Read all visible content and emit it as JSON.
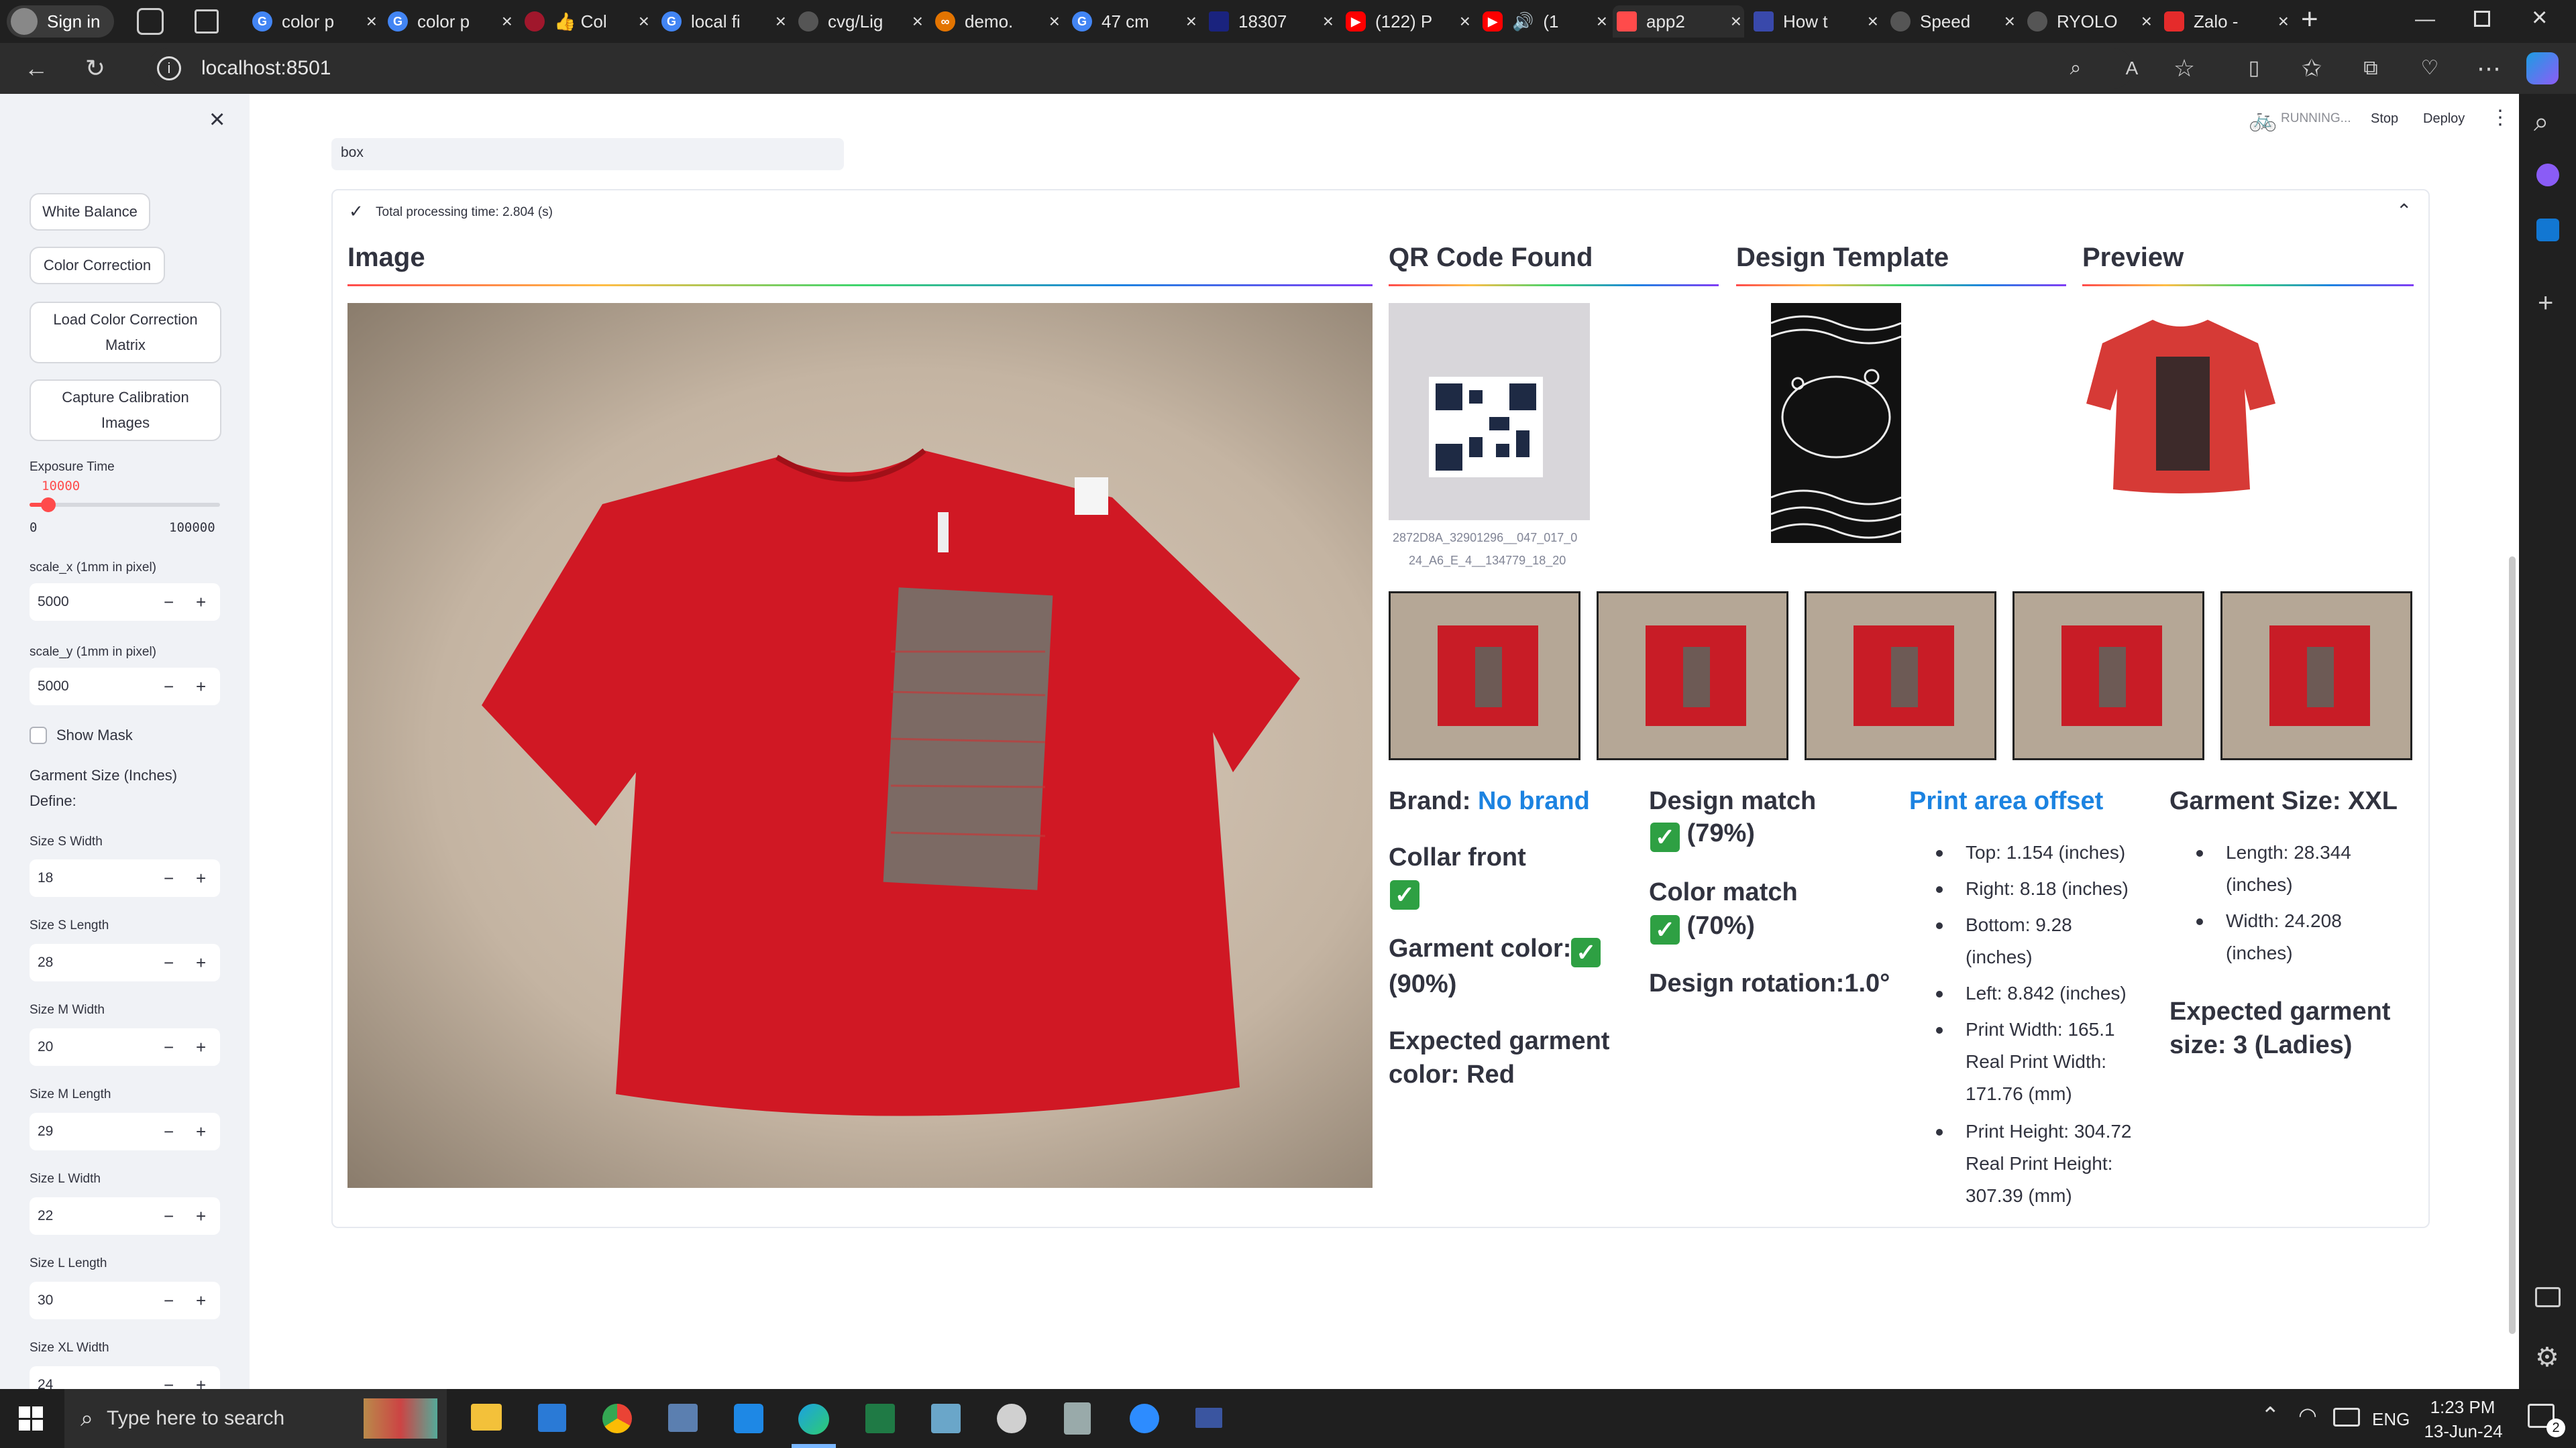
{
  "browser": {
    "profile_label": "Sign in",
    "tabs": [
      {
        "title": "color p",
        "icon": "google-icon"
      },
      {
        "title": "color p",
        "icon": "google-icon"
      },
      {
        "title": "👍 Col",
        "icon": "tool-icon"
      },
      {
        "title": "local fi",
        "icon": "google-icon"
      },
      {
        "title": "cvg/Lig",
        "icon": "github-icon"
      },
      {
        "title": "demo.",
        "icon": "infinity-icon"
      },
      {
        "title": "47 cm",
        "icon": "google-icon"
      },
      {
        "title": "18307",
        "icon": "app-icon"
      },
      {
        "title": "(122) P",
        "icon": "youtube-icon"
      },
      {
        "title": "(1",
        "icon": "youtube-icon"
      },
      {
        "title": "app2",
        "icon": "streamlit-icon"
      },
      {
        "title": "How t",
        "icon": "terminal-icon"
      },
      {
        "title": "Speed",
        "icon": "github-icon"
      },
      {
        "title": "RYOLO",
        "icon": "github-icon"
      },
      {
        "title": "Zalo -",
        "icon": "zalo-icon"
      }
    ],
    "url": "localhost:8501"
  },
  "streamlit_header": {
    "status": "RUNNING...",
    "stop_label": "Stop",
    "deploy_label": "Deploy"
  },
  "sidebar": {
    "buttons": [
      "White Balance",
      "Color Correction",
      "Load Color Correction Matrix",
      "Capture Calibration Images"
    ],
    "exposure": {
      "label": "Exposure Time",
      "value": "10000",
      "min": "0",
      "max": "100000",
      "fraction": 0.1
    },
    "scale_x": {
      "label": "scale_x (1mm in pixel)",
      "value": "5000"
    },
    "scale_y": {
      "label": "scale_y (1mm in pixel)",
      "value": "5000"
    },
    "show_mask_label": "Show Mask",
    "garment_size_title": "Garment Size (Inches)",
    "define_label": "Define:",
    "sizes": [
      {
        "label": "Size S Width",
        "value": "18"
      },
      {
        "label": "Size S Length",
        "value": "28"
      },
      {
        "label": "Size M Width",
        "value": "20"
      },
      {
        "label": "Size M Length",
        "value": "29"
      },
      {
        "label": "Size L Width",
        "value": "22"
      },
      {
        "label": "Size L Length",
        "value": "30"
      },
      {
        "label": "Size XL Width",
        "value": "24"
      }
    ]
  },
  "main": {
    "input_value": "box",
    "status_text": "Total processing time: 2.804 (s)",
    "headers": {
      "image": "Image",
      "qr": "QR Code Found",
      "design": "Design Template",
      "preview": "Preview"
    },
    "qr_caption_1": "2872D8A_32901296__047_017_0",
    "qr_caption_2": "24_A6_E_4__134779_18_20",
    "brand_label": "Brand:",
    "brand_value": "No brand",
    "collar_front": "Collar front",
    "garment_color_label": "Garment color:",
    "garment_color_pct": "(90%)",
    "expected_color": "Expected garment color: Red",
    "design_match_label": "Design match",
    "design_match_pct": "(79%)",
    "color_match_label": "Color match",
    "color_match_pct": "(70%)",
    "design_rotation": "Design rotation:1.0°",
    "print_offset_title": "Print area offset",
    "print_offset_items": [
      "Top: 1.154 (inches)",
      "Right: 8.18 (inches)",
      "Bottom: 9.28",
      "(inches)",
      "Left: 8.842 (inches)",
      "Print Width: 165.1",
      "Real Print Width:",
      "171.76 (mm)",
      "Print Height: 304.72",
      "Real Print Height:",
      "307.39 (mm)"
    ],
    "garment_size_label": "Garment Size: XXL",
    "garment_size_items": [
      "Length: 28.344",
      "(inches)",
      "Width: 24.208",
      "(inches)"
    ],
    "expected_size": "Expected garment size: 3 (Ladies)"
  },
  "taskbar": {
    "search_placeholder": "Type here to search",
    "lang": "ENG",
    "time": "1:23 PM",
    "date": "13-Jun-24",
    "notification_count": "2"
  }
}
